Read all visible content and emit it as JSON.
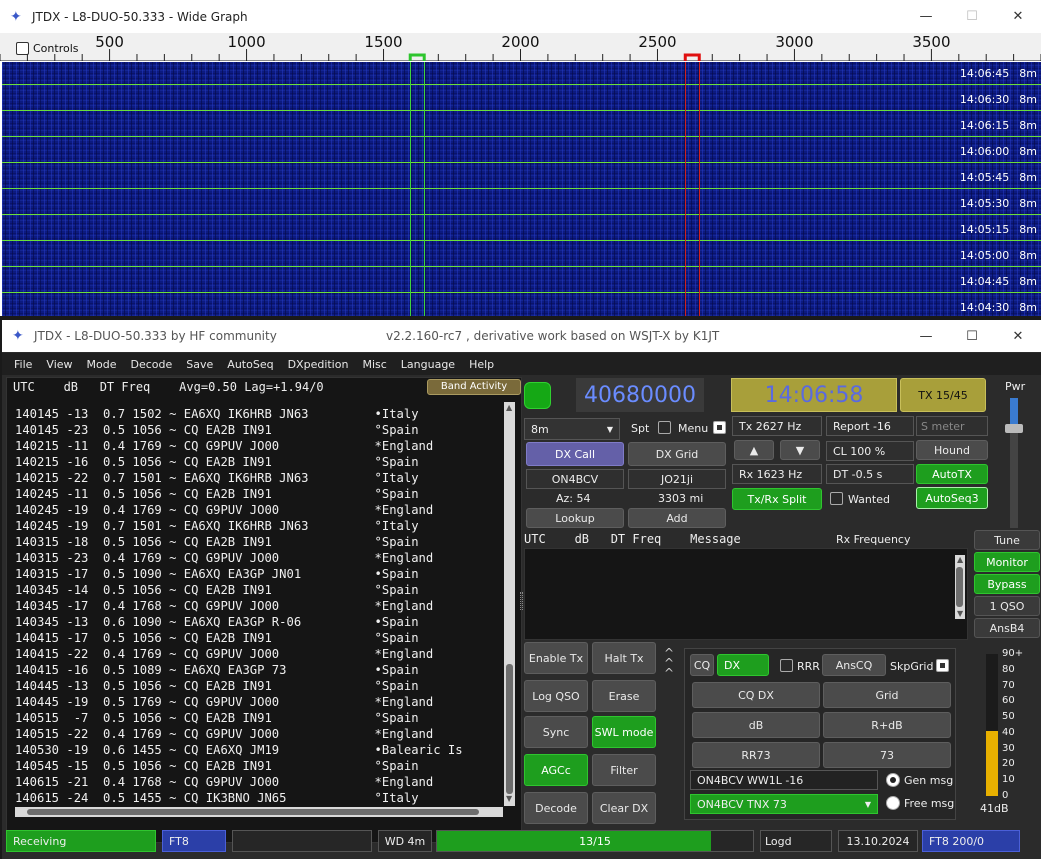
{
  "wide_graph": {
    "title": "JTDX - L8-DUO-50.333 - Wide Graph",
    "controls_label": "Controls",
    "scale_ticks": [
      "500",
      "1000",
      "1500",
      "2000",
      "2500",
      "3000",
      "3500"
    ],
    "scale_hz": [
      500,
      1000,
      1500,
      2000,
      2500,
      3000,
      3500
    ],
    "scale_range_hz": [
      100,
      3900
    ],
    "rx_marker_hz": 1623,
    "tx_marker_hz": 2627,
    "time_rows": [
      {
        "time": "14:06:45",
        "band": "8m"
      },
      {
        "time": "14:06:30",
        "band": "8m"
      },
      {
        "time": "14:06:15",
        "band": "8m"
      },
      {
        "time": "14:06:00",
        "band": "8m"
      },
      {
        "time": "14:05:45",
        "band": "8m"
      },
      {
        "time": "14:05:30",
        "band": "8m"
      },
      {
        "time": "14:05:15",
        "band": "8m"
      },
      {
        "time": "14:05:00",
        "band": "8m"
      },
      {
        "time": "14:04:45",
        "band": "8m"
      },
      {
        "time": "14:04:30",
        "band": "8m"
      }
    ]
  },
  "main": {
    "title": "JTDX - L8-DUO-50.333   by HF community",
    "subtitle": "v2.2.160-rc7 , derivative work based on WSJT-X by K1JT",
    "menu": [
      "File",
      "View",
      "Mode",
      "Decode",
      "Save",
      "AutoSeq",
      "DXpedition",
      "Misc",
      "Language",
      "Help"
    ],
    "band_header": "UTC    dB   DT Freq    Avg=0.50 Lag=+1.94/0",
    "band_activity_label": "Band Activity",
    "band_lines": [
      "140145 -13  0.7 1502 ~ EA6XQ IK6HRB JN63         •Italy",
      "140145 -23  0.5 1056 ~ CQ EA2B IN91              °Spain",
      "140215 -11  0.4 1769 ~ CQ G9PUV JO00             *England",
      "140215 -16  0.5 1056 ~ CQ EA2B IN91              °Spain",
      "140215 -22  0.7 1501 ~ EA6XQ IK6HRB JN63         °Italy",
      "140245 -11  0.5 1056 ~ CQ EA2B IN91              °Spain",
      "140245 -19  0.4 1769 ~ CQ G9PUV JO00             *England",
      "140245 -19  0.7 1501 ~ EA6XQ IK6HRB JN63         °Italy",
      "140315 -18  0.5 1056 ~ CQ EA2B IN91              °Spain",
      "140315 -23  0.4 1769 ~ CQ G9PUV JO00             *England",
      "140315 -17  0.5 1090 ~ EA6XQ EA3GP JN01          •Spain",
      "140345 -14  0.5 1056 ~ CQ EA2B IN91              °Spain",
      "140345 -17  0.4 1768 ~ CQ G9PUV JO00             *England",
      "140345 -13  0.6 1090 ~ EA6XQ EA3GP R-06          •Spain",
      "140415 -17  0.5 1056 ~ CQ EA2B IN91              °Spain",
      "140415 -22  0.4 1769 ~ CQ G9PUV JO00             *England",
      "140415 -16  0.5 1089 ~ EA6XQ EA3GP 73            •Spain",
      "140445 -13  0.5 1056 ~ CQ EA2B IN91              °Spain",
      "140445 -19  0.5 1769 ~ CQ G9PUV JO00             *England",
      "140515  -7  0.5 1056 ~ CQ EA2B IN91              °Spain",
      "140515 -22  0.4 1769 ~ CQ G9PUV JO00             *England",
      "140530 -19  0.6 1455 ~ CQ EA6XQ JM19             •Balearic Is",
      "140545 -15  0.5 1056 ~ CQ EA2B IN91              °Spain",
      "140615 -21  0.4 1768 ~ CQ G9PUV JO00             *England",
      "140615 -24  0.5 1455 ~ CQ IK3BNO JN65            °Italy"
    ],
    "dial_freq": "40680000",
    "utc_time": "14:06:58",
    "tx_period": "TX 15/45",
    "pwr_label": "Pwr",
    "band": "8m",
    "spt_label": "Spt",
    "menu_label": "Menu",
    "dx_call_label": "DX Call",
    "dx_grid_label": "DX Grid",
    "dx_call_value": "ON4BCV",
    "dx_grid_value": "JO21ji",
    "azimuth": "Az: 54",
    "distance": "3303 mi",
    "lookup_label": "Lookup",
    "add_label": "Add",
    "tx_freq": "Tx  2627  Hz",
    "rx_freq": "Rx  1623  Hz",
    "report": "Report -16",
    "smeter": "S meter",
    "cl": "CL  100 %",
    "dt": "DT -0.5 s",
    "hound_label": "Hound",
    "autotx_label": "AutoTX",
    "txrx_split_label": "Tx/Rx Split",
    "wanted_label": "Wanted",
    "autoseq_label": "AutoSeq3",
    "rx_header": "UTC    dB   DT Freq    Message",
    "rx_freq_title": "Rx Frequency",
    "tune_label": "Tune",
    "monitor_label": "Monitor",
    "bypass_label": "Bypass",
    "oneqso_label": "1 QSO",
    "ansb4_label": "AnsB4",
    "enable_tx_label": "Enable Tx",
    "halt_tx_label": "Halt Tx",
    "log_qso_label": "Log QSO",
    "erase_label": "Erase",
    "sync_label": "Sync",
    "swl_label": "SWL mode",
    "agcc_label": "AGCc",
    "filter_label": "Filter",
    "decode_label": "Decode",
    "clear_dx_label": "Clear DX",
    "cq_label": "CQ",
    "dx_label": "DX",
    "rrr_label": "RRR",
    "anscq_label": "AnsCQ",
    "skpgrid_label": "SkpGrid",
    "cqdx_label": "CQ DX",
    "grid_label": "Grid",
    "db_label": "dB",
    "rdb_label": "R+dB",
    "rr73_label": "RR73",
    "s73_label": "73",
    "gen_msg_value": "ON4BCV WW1L -16",
    "free_msg_value": "ON4BCV TNX 73",
    "gen_msg_label": "Gen msg",
    "free_msg_label": "Free msg",
    "meter_ticks": [
      "90+",
      "80",
      "70",
      "60",
      "50",
      "40",
      "30",
      "20",
      "10",
      "0"
    ],
    "meter_level_db": 41,
    "meter_reading": "41dB",
    "status": {
      "state": "Receiving",
      "mode": "FT8",
      "wd": "WD 4m",
      "progress": "13/15",
      "progress_fraction": 0.867,
      "logd": "Logd",
      "date": "13.10.2024",
      "mode_info": "FT8  200/0"
    }
  },
  "colors": {
    "accent_green": "#1e9e1e",
    "waterfall_bg": "#0c1a80",
    "olive": "#a89f3a",
    "purple": "#6460a8",
    "status_blue": "#2b3fa8"
  }
}
